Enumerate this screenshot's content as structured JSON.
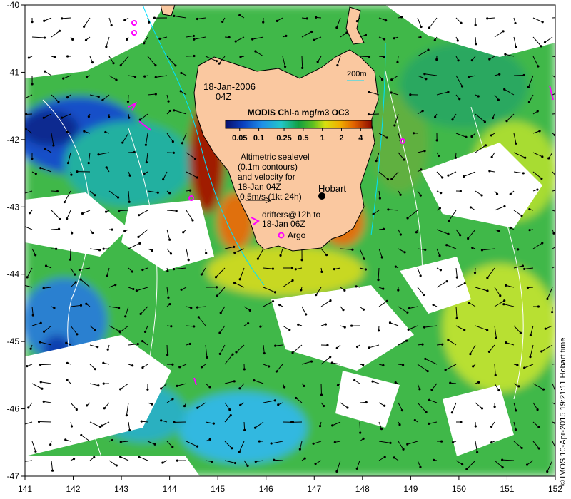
{
  "map": {
    "date_label": "18-Jan-2006",
    "time_label": "04Z",
    "depth_contour_label": "200m",
    "colorbar": {
      "title": "MODIS Chl-a mg/m3 OC3",
      "ticks": [
        "0.05",
        "0.1",
        "0.25",
        "0.5",
        "1",
        "2",
        "4"
      ],
      "colors": [
        "#08106b",
        "#0a3fbf",
        "#1f8fe8",
        "#22c6c8",
        "#12b060",
        "#20b020",
        "#a8e020",
        "#f0d000",
        "#f08000",
        "#c03000",
        "#8b0a00"
      ]
    },
    "altimetry_note": [
      "Altimetric sealevel",
      "(0.1m contours)",
      "and velocity for",
      "18-Jan 04Z",
      "0.5m/s (1kt 24h)"
    ],
    "drifters_note": [
      "drifters@12h to",
      "18-Jan 06Z"
    ],
    "argo_label": "Argo",
    "city_label": "Hobart",
    "credit": "© IMOS 10-Apr-2015 19:21:11 Hobart time",
    "lon_ticks": [
      "141",
      "142",
      "143",
      "144",
      "145",
      "146",
      "147",
      "148",
      "149",
      "150",
      "151",
      "152"
    ],
    "lat_ticks": [
      "-40",
      "-41",
      "-42",
      "-43",
      "-44",
      "-45",
      "-46",
      "-47"
    ],
    "land_color": "#fac8a0",
    "argo_color": "#ff00ff"
  }
}
